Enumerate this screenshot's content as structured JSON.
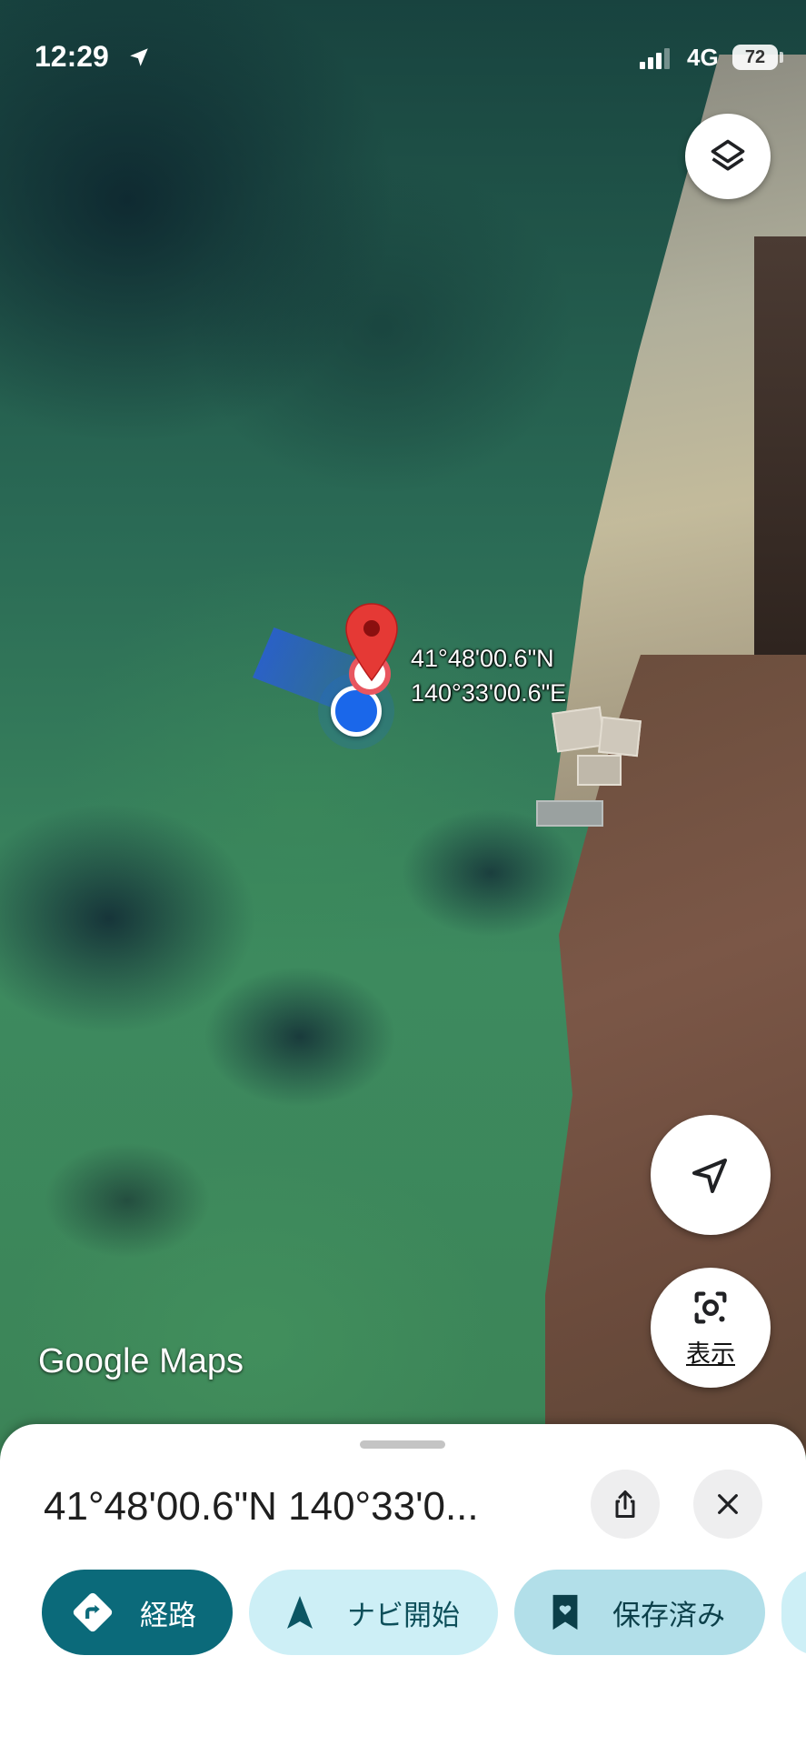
{
  "status_bar": {
    "time": "12:29",
    "network": "4G",
    "battery": "72"
  },
  "map": {
    "pin_coordinates": {
      "lat": "41°48'00.6\"N",
      "lng": "140°33'00.6\"E"
    },
    "branding": "Google Maps",
    "lens_label": "表示",
    "icons": {
      "layers": "layers-icon",
      "locate": "navigation-arrow-icon",
      "lens": "camera-lens-icon"
    }
  },
  "sheet": {
    "title": "41°48'00.6\"N 140°33'0...",
    "share_icon": "share-icon",
    "close_icon": "close-icon",
    "chips": {
      "route": "経路",
      "nav": "ナビ開始",
      "saved": "保存済み"
    }
  },
  "colors": {
    "route_chip": "#0b6a7a",
    "nav_chip": "#cdeff6",
    "saved_chip": "#b2dfe9",
    "pin_red": "#e53935",
    "location_blue": "#1a67ea"
  }
}
